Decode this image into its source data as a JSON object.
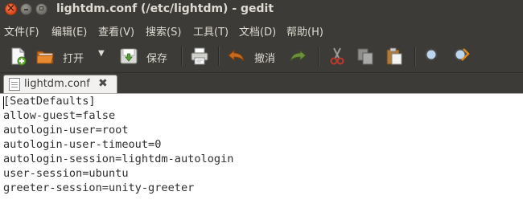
{
  "window": {
    "title": "lightdm.conf (/etc/lightdm) - gedit"
  },
  "menu": [
    {
      "label": "文件(F)"
    },
    {
      "label": "编辑(E)"
    },
    {
      "label": "查看(V)"
    },
    {
      "label": "搜索(S)"
    },
    {
      "label": "工具(T)"
    },
    {
      "label": "文档(D)"
    },
    {
      "label": "帮助(H)"
    }
  ],
  "toolbar": {
    "open_label": "打开",
    "save_label": "保存",
    "undo_label": "撤消"
  },
  "tabs": [
    {
      "label": "lightdm.conf"
    }
  ],
  "editor": {
    "lines": [
      "[SeatDefaults]",
      "allow-guest=false",
      "autologin-user=root",
      "autologin-user-timeout=0",
      "autologin-session=lightdm-autologin",
      "user-session=ubuntu",
      "greeter-session=unity-greeter"
    ]
  },
  "colors": {
    "chrome": "#3c3b37",
    "close_button": "#e9592a",
    "chrome_text": "#dfdbd2",
    "editor_bg": "#ffffff"
  }
}
